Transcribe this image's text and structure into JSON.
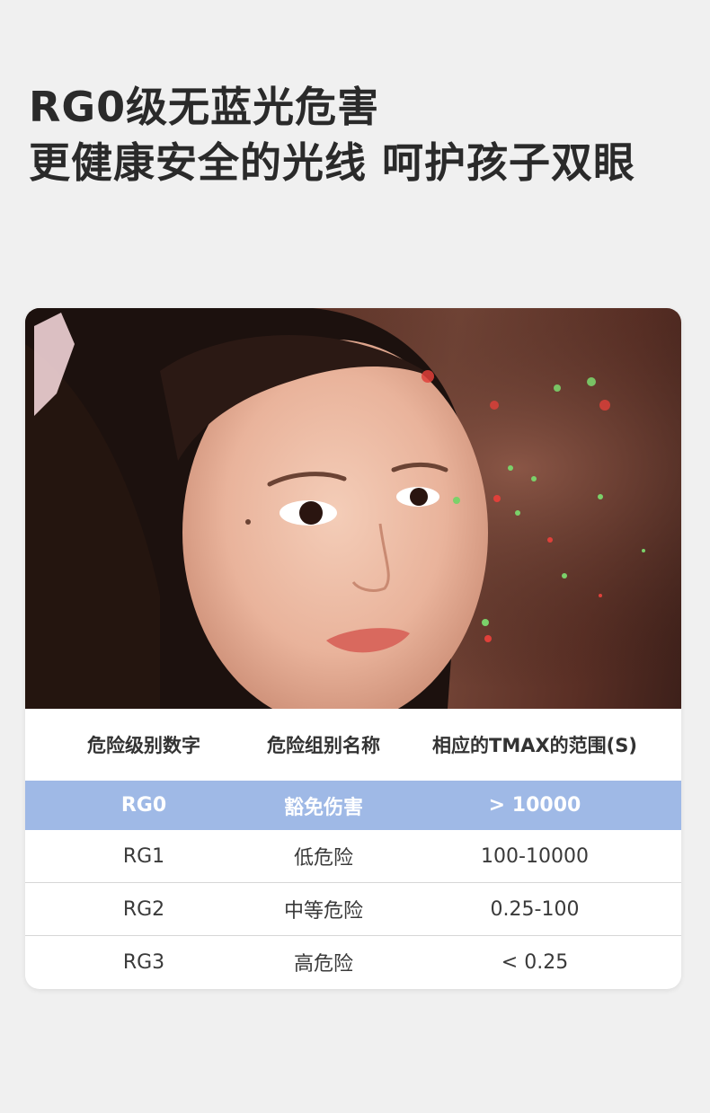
{
  "headline": {
    "line1": "RG0级无蓝光危害",
    "line2": "更健康安全的光线 呵护孩子双眼"
  },
  "table": {
    "headers": [
      "危险级别数字",
      "危险组别名称",
      "相应的TMAX的范围(S)"
    ],
    "rows": [
      [
        "RG0",
        "豁免伤害",
        "> 10000"
      ],
      [
        "RG1",
        "低危险",
        "100-10000"
      ],
      [
        "RG2",
        "中等危险",
        "0.25-100"
      ],
      [
        "RG3",
        "高危险",
        "< 0.25"
      ]
    ],
    "highlight_color": "#9fb9e6"
  }
}
